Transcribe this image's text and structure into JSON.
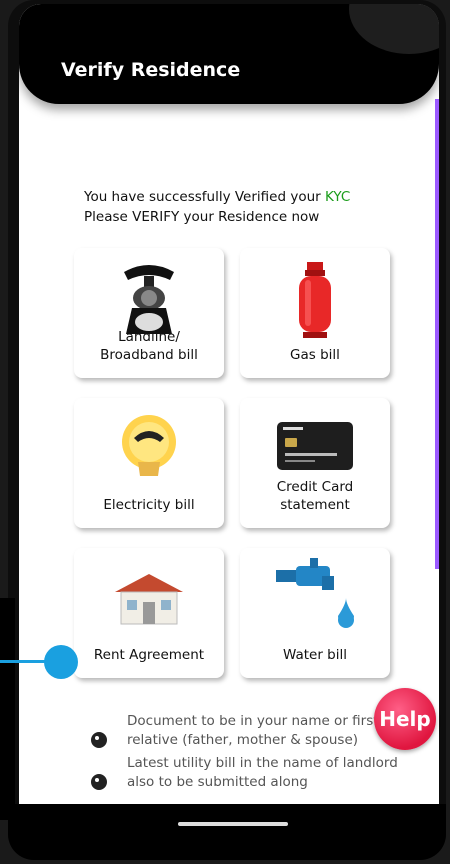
{
  "header": {
    "title": "Verify Residence"
  },
  "intro": {
    "line1_prefix": "You have successfully Verified your ",
    "line1_kyc": "KYC",
    "line2": "Please VERIFY your Residence now"
  },
  "options": [
    {
      "label_line1": "Landline/",
      "label_line2": "Broadband bill",
      "icon": "telephone-icon"
    },
    {
      "label_line1": "Gas bill",
      "label_line2": "",
      "icon": "gas-cylinder-icon"
    },
    {
      "label_line1": "Electricity bill",
      "label_line2": "",
      "icon": "light-bulb-icon"
    },
    {
      "label_line1": "Credit Card",
      "label_line2": "statement",
      "icon": "credit-card-icon"
    },
    {
      "label_line1": "Rent Agreement",
      "label_line2": "",
      "icon": "house-icon"
    },
    {
      "label_line1": "Water bill",
      "label_line2": "",
      "icon": "water-tap-icon"
    }
  ],
  "bullets": [
    {
      "text": "Document to be in your name or first blood relative (father, mother & spouse)"
    },
    {
      "text": "Latest utility bill in the name of landlord also to be submitted along"
    }
  ],
  "help": {
    "label": "Help"
  },
  "colors": {
    "kyc_green": "#1a9c1a",
    "help_red": "#e0163f",
    "accent_purple": "#9b59ff",
    "pointer_blue": "#1aa0e0"
  }
}
